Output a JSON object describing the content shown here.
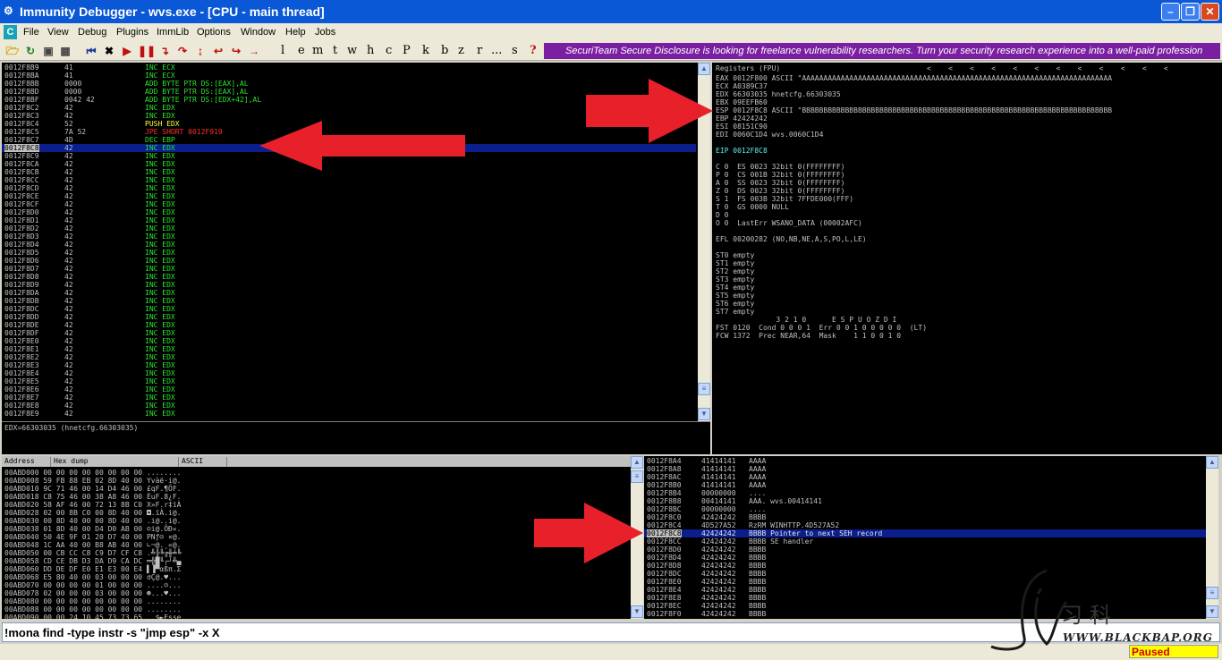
{
  "window": {
    "title": "Immunity Debugger - wvs.exe - [CPU - main thread]",
    "app_icon": "debugger-icon"
  },
  "menu": [
    "File",
    "View",
    "Debug",
    "Plugins",
    "ImmLib",
    "Options",
    "Window",
    "Help",
    "Jobs"
  ],
  "toolbar": {
    "letters": [
      "l",
      "e",
      "m",
      "t",
      "w",
      "h",
      "c",
      "P",
      "k",
      "b",
      "z",
      "r",
      "...",
      "s",
      "?"
    ]
  },
  "banner": "SecuriTeam Secure Disclosure is looking for freelance vulnerability researchers. Turn your security research experience into a well-paid profession",
  "disasm": {
    "rows": [
      {
        "addr": "0012F8B9",
        "hex": "41",
        "instr": "INC ECX",
        "color": "grn"
      },
      {
        "addr": "0012F8BA",
        "hex": "41",
        "instr": "INC ECX",
        "color": "grn"
      },
      {
        "addr": "0012F8BB",
        "hex": "0000",
        "instr": "ADD BYTE PTR DS:[EAX],AL",
        "color": "grn"
      },
      {
        "addr": "0012F8BD",
        "hex": "0000",
        "instr": "ADD BYTE PTR DS:[EAX],AL",
        "color": "grn"
      },
      {
        "addr": "0012F8BF",
        "hex": "0042 42",
        "instr": "ADD BYTE PTR DS:[EDX+42],AL",
        "color": "grn"
      },
      {
        "addr": "0012F8C2",
        "hex": "42",
        "instr": "INC EDX",
        "color": "grn"
      },
      {
        "addr": "0012F8C3",
        "hex": "42",
        "instr": "INC EDX",
        "color": "grn"
      },
      {
        "addr": "0012F8C4",
        "hex": "52",
        "instr": "PUSH EDX",
        "color": "yel"
      },
      {
        "addr": "0012F8C5",
        "hex": "7A 52",
        "instr": "JPE SHORT 0012F919",
        "color": "red"
      },
      {
        "addr": "0012F8C7",
        "hex": "4D",
        "instr": "DEC EBP",
        "color": "grn"
      },
      {
        "addr": "0012F8C8",
        "hex": "42",
        "instr": "INC EDX",
        "color": "grn",
        "selected": true
      },
      {
        "addr": "0012F8C9",
        "hex": "42",
        "instr": "INC EDX",
        "color": "grn"
      },
      {
        "addr": "0012F8CA",
        "hex": "42",
        "instr": "INC EDX",
        "color": "grn"
      },
      {
        "addr": "0012F8CB",
        "hex": "42",
        "instr": "INC EDX",
        "color": "grn"
      },
      {
        "addr": "0012F8CC",
        "hex": "42",
        "instr": "INC EDX",
        "color": "grn"
      },
      {
        "addr": "0012F8CD",
        "hex": "42",
        "instr": "INC EDX",
        "color": "grn"
      },
      {
        "addr": "0012F8CE",
        "hex": "42",
        "instr": "INC EDX",
        "color": "grn"
      },
      {
        "addr": "0012F8CF",
        "hex": "42",
        "instr": "INC EDX",
        "color": "grn"
      },
      {
        "addr": "0012F8D0",
        "hex": "42",
        "instr": "INC EDX",
        "color": "grn"
      },
      {
        "addr": "0012F8D1",
        "hex": "42",
        "instr": "INC EDX",
        "color": "grn"
      },
      {
        "addr": "0012F8D2",
        "hex": "42",
        "instr": "INC EDX",
        "color": "grn"
      },
      {
        "addr": "0012F8D3",
        "hex": "42",
        "instr": "INC EDX",
        "color": "grn"
      },
      {
        "addr": "0012F8D4",
        "hex": "42",
        "instr": "INC EDX",
        "color": "grn"
      },
      {
        "addr": "0012F8D5",
        "hex": "42",
        "instr": "INC EDX",
        "color": "grn"
      },
      {
        "addr": "0012F8D6",
        "hex": "42",
        "instr": "INC EDX",
        "color": "grn"
      },
      {
        "addr": "0012F8D7",
        "hex": "42",
        "instr": "INC EDX",
        "color": "grn"
      },
      {
        "addr": "0012F8D8",
        "hex": "42",
        "instr": "INC EDX",
        "color": "grn"
      },
      {
        "addr": "0012F8D9",
        "hex": "42",
        "instr": "INC EDX",
        "color": "grn"
      },
      {
        "addr": "0012F8DA",
        "hex": "42",
        "instr": "INC EDX",
        "color": "grn"
      },
      {
        "addr": "0012F8DB",
        "hex": "42",
        "instr": "INC EDX",
        "color": "grn"
      },
      {
        "addr": "0012F8DC",
        "hex": "42",
        "instr": "INC EDX",
        "color": "grn"
      },
      {
        "addr": "0012F8DD",
        "hex": "42",
        "instr": "INC EDX",
        "color": "grn"
      },
      {
        "addr": "0012F8DE",
        "hex": "42",
        "instr": "INC EDX",
        "color": "grn"
      },
      {
        "addr": "0012F8DF",
        "hex": "42",
        "instr": "INC EDX",
        "color": "grn"
      },
      {
        "addr": "0012F8E0",
        "hex": "42",
        "instr": "INC EDX",
        "color": "grn"
      },
      {
        "addr": "0012F8E1",
        "hex": "42",
        "instr": "INC EDX",
        "color": "grn"
      },
      {
        "addr": "0012F8E2",
        "hex": "42",
        "instr": "INC EDX",
        "color": "grn"
      },
      {
        "addr": "0012F8E3",
        "hex": "42",
        "instr": "INC EDX",
        "color": "grn"
      },
      {
        "addr": "0012F8E4",
        "hex": "42",
        "instr": "INC EDX",
        "color": "grn"
      },
      {
        "addr": "0012F8E5",
        "hex": "42",
        "instr": "INC EDX",
        "color": "grn"
      },
      {
        "addr": "0012F8E6",
        "hex": "42",
        "instr": "INC EDX",
        "color": "grn"
      },
      {
        "addr": "0012F8E7",
        "hex": "42",
        "instr": "INC EDX",
        "color": "grn"
      },
      {
        "addr": "0012F8E8",
        "hex": "42",
        "instr": "INC EDX",
        "color": "grn"
      },
      {
        "addr": "0012F8E9",
        "hex": "42",
        "instr": "INC EDX",
        "color": "grn"
      }
    ]
  },
  "info_line": "EDX=66303035 (hnetcfg.66303035)",
  "registers": {
    "header": "Registers (FPU)",
    "lines": [
      "EAX 0012F800 ASCII \"AAAAAAAAAAAAAAAAAAAAAAAAAAAAAAAAAAAAAAAAAAAAAAAAAAAAAAAAAAAAAAAAAAAAAAAA",
      "ECX A0389C37",
      "EDX 66303035 hnetcfg.66303035",
      "EBX 09EEFB60",
      "ESP 0012F8C8 ASCII \"BBBBBBBBBBBBBBBBBBBBBBBBBBBBBBBBBBBBBBBBBBBBBBBBBBBBBBBBBBBBBBBBBBBBBBBB",
      "EBP 42424242",
      "ESI 08151C90",
      "EDI 0060C1D4 wvs.0060C1D4",
      "",
      "EIP 0012F8C8",
      "",
      "C 0  ES 0023 32bit 0(FFFFFFFF)",
      "P 0  CS 001B 32bit 0(FFFFFFFF)",
      "A 0  SS 0023 32bit 0(FFFFFFFF)",
      "Z 0  DS 0023 32bit 0(FFFFFFFF)",
      "S 1  FS 003B 32bit 7FFDE000(FFF)",
      "T 0  GS 0000 NULL",
      "D 0",
      "O 0  LastErr WSANO_DATA (00002AFC)",
      "",
      "EFL 00200282 (NO,NB,NE,A,S,PO,L,LE)",
      "",
      "ST0 empty",
      "ST1 empty",
      "ST2 empty",
      "ST3 empty",
      "ST4 empty",
      "ST5 empty",
      "ST6 empty",
      "ST7 empty",
      "              3 2 1 0      E S P U O Z D I",
      "FST 0120  Cond 0 0 0 1  Err 0 0 1 0 0 0 0 0  (LT)",
      "FCW 1372  Prec NEAR,64  Mask    1 1 0 0 1 0"
    ]
  },
  "hexdump": {
    "headers": [
      "Address",
      "Hex dump",
      "ASCII"
    ],
    "rows": [
      "00ABD000 00 00 00 00 00 00 00 00 ........",
      "00ABD008 59 FB 88 EB 02 8D 40 00 Yvàë·i@.",
      "00ABD010 9C 71 46 00 14 D4 46 00 £qF.¶ÔF.",
      "00ABD018 C8 75 46 00 38 A8 46 00 ÈuF.8¿F.",
      "00ABD020 58 AF 46 00 72 13 8B C0 X»F.r‡ïÀ",
      "00ABD028 02 00 8B C0 00 8D 40 00 ◘.ïÀ.i@.",
      "00ABD030 00 8D 40 00 00 8D 40 00 .i@..i@.",
      "00ABD038 01 8D 40 00 D4 D0 AB 00 ☺i@.ÔÐ«.",
      "00ABD040 50 4E 9F 01 20 D7 40 00 PNƒ☺ ×@.",
      "00ABD048 1C AA 40 00 B8 AB 40 00 ∟¬@.¸«@.",
      "00ABD050 00 CB CC C8 C9 D7 CF C8 .╩╠╚╔╫╧╚",
      "00ABD058 CD CE DB D3 DA D9 CA DC ═╬█╙┌┘╩▄",
      "00ABD060 DD DE DF E0 E1 E3 00 E4 ▌▐▀αßπ.Σ",
      "00ABD068 E5 80 40 00 03 00 00 00 σÇ@.♥...",
      "00ABD070 00 00 00 00 01 00 00 00 ....☺...",
      "00ABD078 02 00 00 00 03 00 00 00 ☻...♥...",
      "00ABD080 00 00 00 00 00 00 00 00 ........",
      "00ABD088 00 00 00 00 00 00 00 00 ........",
      "00ABD090 00 00 24 10 45 73 73 65 ..$►Esse"
    ]
  },
  "stack": {
    "rows": [
      {
        "addr": "0012F8A4",
        "val": "41414141",
        "comment": "AAAA"
      },
      {
        "addr": "0012F8A8",
        "val": "41414141",
        "comment": "AAAA"
      },
      {
        "addr": "0012F8AC",
        "val": "41414141",
        "comment": "AAAA"
      },
      {
        "addr": "0012F8B0",
        "val": "41414141",
        "comment": "AAAA"
      },
      {
        "addr": "0012F8B4",
        "val": "00000000",
        "comment": "...."
      },
      {
        "addr": "0012F8B8",
        "val": "00414141",
        "comment": "AAA. wvs.00414141"
      },
      {
        "addr": "0012F8BC",
        "val": "00000000",
        "comment": "...."
      },
      {
        "addr": "0012F8C0",
        "val": "42424242",
        "comment": "BBBB"
      },
      {
        "addr": "0012F8C4",
        "val": "4D527A52",
        "comment": "RzRM WINHTTP.4D527A52"
      },
      {
        "addr": "0012F8C8",
        "val": "42424242",
        "comment": "BBBB Pointer to next SEH record",
        "selected": true
      },
      {
        "addr": "0012F8CC",
        "val": "42424242",
        "comment": "BBBB SE handler"
      },
      {
        "addr": "0012F8D0",
        "val": "42424242",
        "comment": "BBBB"
      },
      {
        "addr": "0012F8D4",
        "val": "42424242",
        "comment": "BBBB"
      },
      {
        "addr": "0012F8D8",
        "val": "42424242",
        "comment": "BBBB"
      },
      {
        "addr": "0012F8DC",
        "val": "42424242",
        "comment": "BBBB"
      },
      {
        "addr": "0012F8E0",
        "val": "42424242",
        "comment": "BBBB"
      },
      {
        "addr": "0012F8E4",
        "val": "42424242",
        "comment": "BBBB"
      },
      {
        "addr": "0012F8E8",
        "val": "42424242",
        "comment": "BBBB"
      },
      {
        "addr": "0012F8EC",
        "val": "42424242",
        "comment": "BBBB"
      },
      {
        "addr": "0012F8F0",
        "val": "42424242",
        "comment": "BBBB"
      }
    ]
  },
  "command": {
    "value": "!mona find -type instr -s \"jmp esp\" -x X"
  },
  "status": {
    "state": "Paused"
  },
  "watermark": {
    "site": "WWW.BLACKBAP.ORG",
    "cn": "习科"
  },
  "colors": {
    "accent_arrow": "#e8202a",
    "title_blue": "#0a58d6",
    "selection": "#0a1e8c"
  }
}
